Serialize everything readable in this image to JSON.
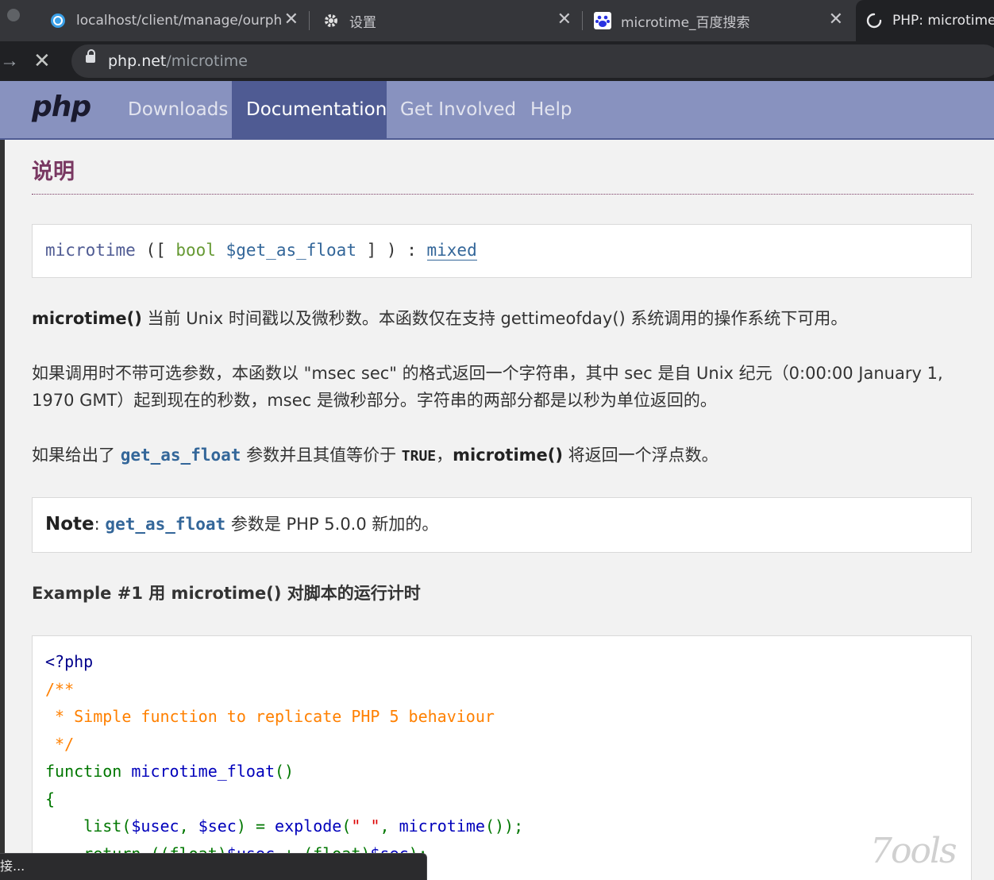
{
  "browser": {
    "tabs": [
      {
        "title": "localhost/client/manage/ourph",
        "favicon": "compass-icon"
      },
      {
        "title": "设置",
        "favicon": "gear-icon"
      },
      {
        "title": "microtime_百度搜索",
        "favicon": "baidu-paw-icon"
      },
      {
        "title": "PHP: microtime",
        "favicon": "loading-spinner-icon"
      }
    ],
    "url_host": "php.net",
    "url_path": "/microtime"
  },
  "nav": {
    "logo": "php",
    "items": [
      "Downloads",
      "Documentation",
      "Get Involved",
      "Help"
    ],
    "active": "Documentation"
  },
  "content": {
    "section_title": "说明",
    "signature": {
      "fn": "microtime",
      "open": " ([ ",
      "type": "bool",
      "var": "$get_as_float",
      "close": " ] ) : ",
      "ret": "mixed"
    },
    "p1": {
      "fn": "microtime()",
      "text": " 当前 Unix 时间戳以及微秒数。本函数仅在支持 gettimeofday() 系统调用的操作系统下可用。"
    },
    "p2": "如果调用时不带可选参数，本函数以 \"msec sec\" 的格式返回一个字符串，其中 sec 是自 Unix 纪元（0:00:00 January 1, 1970 GMT）起到现在的秒数，msec 是微秒部分。字符串的两部分都是以秒为单位返回的。",
    "p3": {
      "pre": "如果给出了 ",
      "param": "get_as_float",
      "mid": " 参数并且其值等价于 ",
      "const": "TRUE",
      "mid2": "，",
      "fn": "microtime()",
      "post": " 将返回一个浮点数。"
    },
    "note": {
      "label": "Note",
      "colon": ": ",
      "param": "get_as_float",
      "text": " 参数是 PHP 5.0.0 新加的。"
    },
    "example_title": "Example #1 用 microtime() 对脚本的运行计时",
    "code": {
      "l1": "<?php",
      "l2": "/**",
      "l3": " * Simple function to replicate PHP 5 behaviour",
      "l4": " */",
      "l5_kw": "function ",
      "l5_id": "microtime_float",
      "l5_p": "()",
      "l6": "{",
      "l7_a": "    list(",
      "l7_b": "$usec",
      "l7_c": ", ",
      "l7_d": "$sec",
      "l7_e": ") = ",
      "l7_f": "explode",
      "l7_g": "(",
      "l7_h": "\" \"",
      "l7_i": ", ",
      "l7_j": "microtime",
      "l7_k": "());",
      "l8_a": "    return ((float)",
      "l8_b": "$usec",
      "l8_c": " + (float)",
      "l8_d": "$sec",
      "l8_e": ");"
    }
  },
  "status_bar": "接...",
  "watermark": "7ools"
}
